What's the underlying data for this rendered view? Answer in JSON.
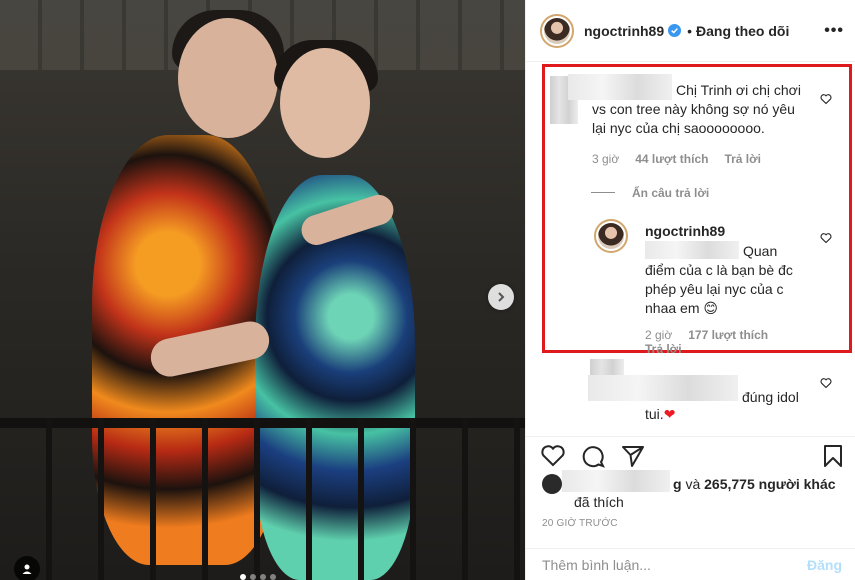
{
  "header": {
    "username": "ngoctrinh89",
    "separator": "•",
    "follow_status": "Đang theo dõi",
    "more_icon": "more-horizontal-icon"
  },
  "comment1": {
    "line1": "Chị Trinh ơi chị chơi",
    "line2": "vs con tree này không sợ nó yêu",
    "line3": "lại nyc của chị saoooooooo.",
    "time": "3 giờ",
    "likes": "44 lượt thích",
    "reply": "Trả lời"
  },
  "hide_replies": "Ẩn câu trả lời",
  "reply1": {
    "username": "ngoctrinh89",
    "line1": "Quan",
    "line2": "điểm của c là bạn bè đc",
    "line3": "phép yêu lại nyc của c",
    "line4": "nhaa em 😊",
    "time": "2 giờ",
    "likes": "177 lượt thích",
    "reply": "Trả lời"
  },
  "comment2": {
    "line1": "đúng idol",
    "line2": "tui.",
    "heart": "❤"
  },
  "likes": {
    "partial": "g",
    "and": "và",
    "count": "265,775",
    "others": "người khác",
    "liked": "đã thích"
  },
  "timestamp": "20 GIỜ TRƯỚC",
  "add_comment": {
    "placeholder": "Thêm bình luận...",
    "post": "Đăng"
  },
  "colors": {
    "highlight_border": "#e0191d",
    "verified": "#3897f0",
    "post_disabled": "#b2dffc"
  }
}
